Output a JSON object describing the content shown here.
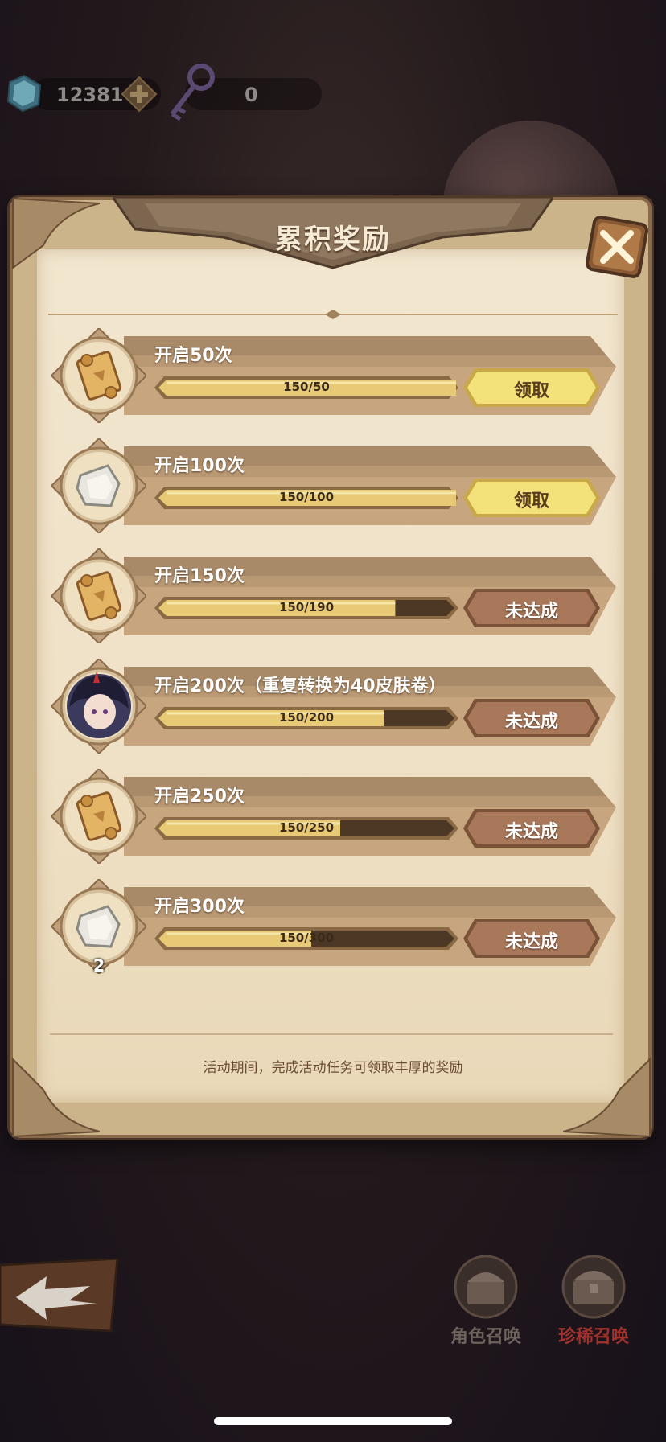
{
  "currency": {
    "gems": "12381",
    "keys": "0"
  },
  "panel": {
    "title": "累积奖励",
    "footer_note": "活动期间，完成活动任务可领取丰厚的奖励"
  },
  "rows": [
    {
      "title": "开启50次",
      "progress_text": "150/50",
      "progress": 1.0,
      "button": "领取",
      "state": "claim",
      "icon": "scroll-icon",
      "count": ""
    },
    {
      "title": "开启100次",
      "progress_text": "150/100",
      "progress": 1.0,
      "button": "领取",
      "state": "claim",
      "icon": "stone-icon",
      "count": ""
    },
    {
      "title": "开启150次",
      "progress_text": "150/190",
      "progress": 0.79,
      "button": "未达成",
      "state": "locked",
      "icon": "scroll-icon",
      "count": ""
    },
    {
      "title": "开启200次（重复转换为40皮肤卷）",
      "progress_text": "150/200",
      "progress": 0.75,
      "button": "未达成",
      "state": "locked",
      "icon": "character-portrait-icon",
      "count": ""
    },
    {
      "title": "开启250次",
      "progress_text": "150/250",
      "progress": 0.6,
      "button": "未达成",
      "state": "locked",
      "icon": "scroll-icon",
      "count": ""
    },
    {
      "title": "开启300次",
      "progress_text": "150/300",
      "progress": 0.5,
      "button": "未达成",
      "state": "locked",
      "icon": "stone-icon",
      "count": "2"
    }
  ],
  "bottom": {
    "summon_character": "角色召唤",
    "summon_rare": "珍稀召唤"
  },
  "colors": {
    "claim_button": "#f3e27a",
    "locked_button": "#a9785a",
    "bar_fill": "#e8c975",
    "bar_empty": "#4d3826",
    "rare_label": "#a0312c"
  }
}
